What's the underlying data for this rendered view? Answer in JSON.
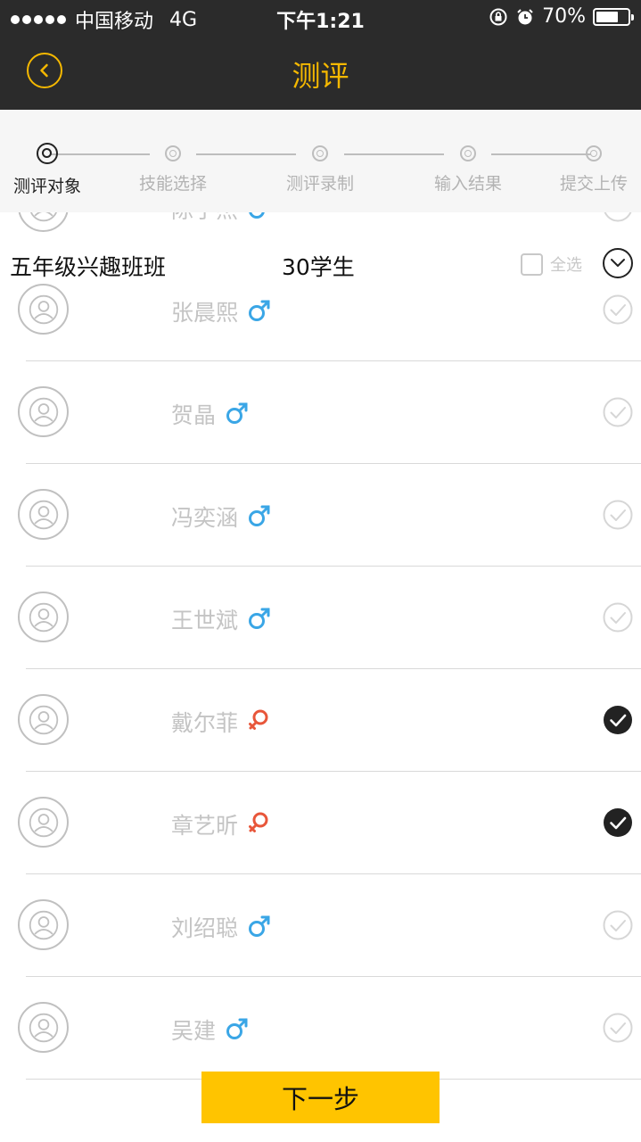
{
  "status_bar": {
    "carrier": "中国移动",
    "network": "4G",
    "time": "下午1:21",
    "battery": "70%",
    "battery_level": 0.7
  },
  "header": {
    "title": "测评",
    "back_icon": "back-arrow-icon"
  },
  "steps": [
    {
      "label": "测评对象",
      "active": true
    },
    {
      "label": "技能选择",
      "active": false
    },
    {
      "label": "测评录制",
      "active": false
    },
    {
      "label": "输入结果",
      "active": false
    },
    {
      "label": "提交上传",
      "active": false
    }
  ],
  "class_info": {
    "name": "五年级兴趣班班",
    "count": "30学生",
    "select_all": "全选"
  },
  "partial_student": {
    "name": "陈子杰",
    "gender": "male"
  },
  "students": [
    {
      "name": "张晨熙",
      "gender": "male",
      "checked": false
    },
    {
      "name": "贺晶",
      "gender": "male",
      "checked": false
    },
    {
      "name": "冯奕涵",
      "gender": "male",
      "checked": false
    },
    {
      "name": "王世斌",
      "gender": "male",
      "checked": false
    },
    {
      "name": "戴尔菲",
      "gender": "female",
      "checked": true
    },
    {
      "name": "章艺昕",
      "gender": "female",
      "checked": true
    },
    {
      "name": "刘绍聪",
      "gender": "male",
      "checked": false
    },
    {
      "name": "吴建",
      "gender": "male",
      "checked": false
    }
  ],
  "footer": {
    "next_label": "下一步"
  },
  "colors": {
    "accent": "#f5b800",
    "button": "#ffc400",
    "male": "#3aa6e6",
    "female": "#e8563a",
    "dark": "#2b2b2b"
  }
}
